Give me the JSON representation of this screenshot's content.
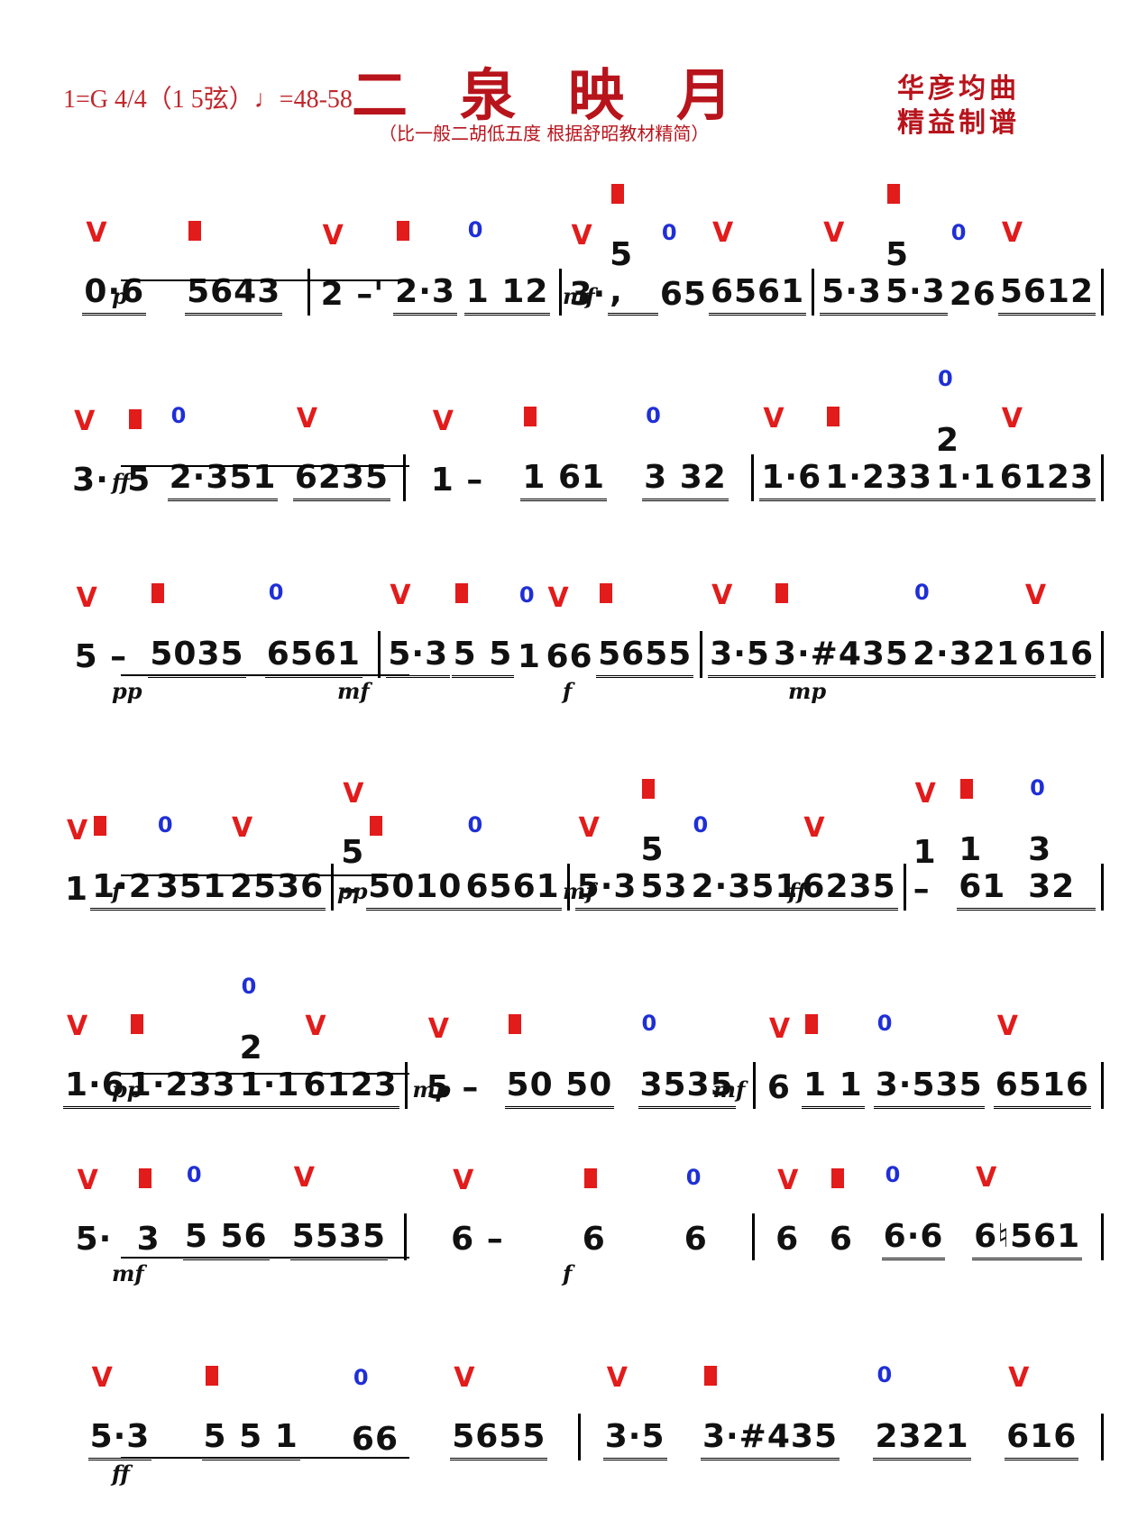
{
  "header": {
    "key": "1=G 4/4（1 5弦）♩=48-58",
    "title": "二泉映月",
    "subtitle": "（比一般二胡低五度 根据舒昭教材精简）",
    "composer": "华彦均曲",
    "arranger": "精益制谱"
  },
  "colors": {
    "title": "#b8141c",
    "bowing": "#e21b1b",
    "fingering": "#1f2fd6"
  },
  "lines": [
    {
      "measures": [
        [
          "0·6",
          "5643"
        ],
        [
          "2 –'",
          "2·3",
          "1 12"
        ],
        [
          "3·",
          "5 ,",
          "65",
          "6561"
        ],
        [
          "5·3",
          "5 5·3",
          "26",
          "5612"
        ]
      ],
      "dynamics": [
        "p",
        "mf"
      ]
    },
    {
      "measures": [
        [
          "3·",
          "5",
          "2·351",
          "6235"
        ],
        [
          "1 –",
          "1 61",
          "3 32"
        ],
        [
          "1·6",
          "1·233",
          "2 1·1",
          "6123"
        ]
      ],
      "dynamics": [
        "ff"
      ]
    },
    {
      "measures": [
        [
          "5 –",
          "5035",
          "6561"
        ],
        [
          "5·3",
          "5 5",
          "1",
          "66",
          "5655"
        ],
        [
          "3·5",
          "3·#435",
          "2·321",
          "616"
        ]
      ],
      "dynamics": [
        "pp",
        "mf",
        "f",
        "mp"
      ]
    },
    {
      "measures": [
        [
          "1",
          "1·2",
          "351",
          "2536"
        ],
        [
          "5 –",
          "5010",
          "6561"
        ],
        [
          "5·3",
          "5 53",
          "2·351",
          "6235"
        ],
        [
          "1 –",
          "1 61",
          "3 32"
        ]
      ],
      "dynamics": [
        "f",
        "pp",
        "mf",
        "ff"
      ]
    },
    {
      "measures": [
        [
          "1·6",
          "1·233",
          "2 1·1",
          "6123"
        ],
        [
          "5 –",
          "50 50",
          "3535"
        ],
        [
          "6",
          "1 1",
          "3·535",
          "6516"
        ]
      ],
      "dynamics": [
        "pp",
        "mp",
        "mf"
      ]
    },
    {
      "measures": [
        [
          "5·",
          "3",
          "5 56",
          "5535"
        ],
        [
          "6 –",
          "6",
          "6"
        ],
        [
          "6",
          "6",
          "6·6",
          "6♮561"
        ]
      ],
      "dynamics": [
        "mf",
        "f"
      ]
    },
    {
      "measures": [
        [
          "5·3",
          "5 5 1",
          "66",
          "5655"
        ],
        [
          "3·5",
          "3·#435",
          "2321",
          "616"
        ]
      ],
      "dynamics": [
        "ff"
      ]
    }
  ]
}
